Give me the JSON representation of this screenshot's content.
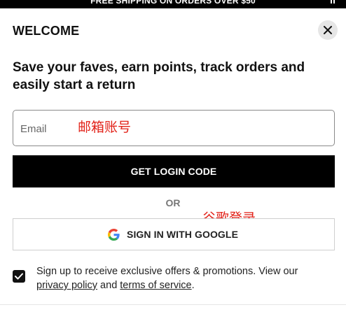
{
  "promo": {
    "text": "FREE SHIPPING ON ORDERS OVER $50"
  },
  "modal": {
    "title": "WELCOME",
    "headline": "Save your faves, earn points, track orders and easily start a return"
  },
  "email": {
    "placeholder": "Email",
    "value": ""
  },
  "annotations": {
    "email_note": "邮箱账号",
    "google_note": "谷歌登录"
  },
  "buttons": {
    "login_code": "GET LOGIN CODE",
    "or": "OR",
    "google": "SIGN IN WITH GOOGLE"
  },
  "consent": {
    "checked": true,
    "text_before": "Sign up to receive exclusive offers & promotions. View our ",
    "privacy_link": "privacy policy",
    "and": " and ",
    "terms_link": "terms of service",
    "period": "."
  },
  "icons": {
    "close": "close-icon",
    "google": "google-icon",
    "check": "checkmark-icon",
    "pause": "pause-icon"
  },
  "colors": {
    "primary": "#000000",
    "annotation": "#e2231a",
    "close_bg": "#e6e6e6"
  }
}
